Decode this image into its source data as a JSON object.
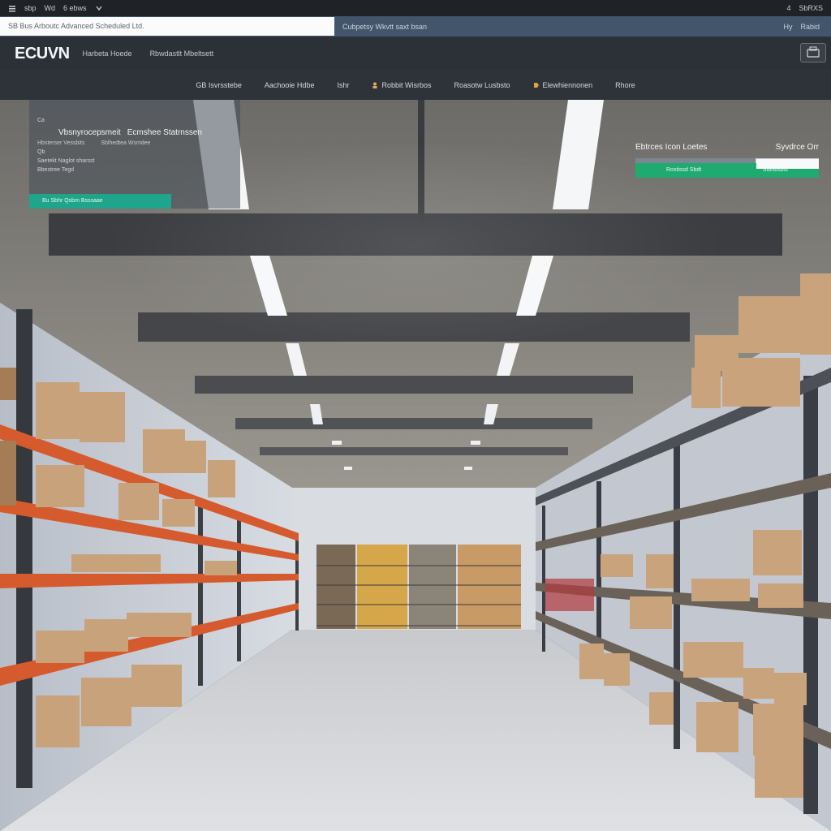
{
  "system_bar": {
    "items": [
      "sbp",
      "Wd",
      "6 ebws"
    ],
    "right": [
      "4",
      "SbRXS"
    ]
  },
  "url_bar": {
    "value": "SB Bus Arboutc Advanced Scheduled Ltd.",
    "center_text": "Cubpetsy Wkvtt saxt bsan",
    "right_text": [
      "Hy",
      "Rabid"
    ]
  },
  "header": {
    "logo": "ECUVN",
    "subnav": [
      "Harbeta Hoede",
      "Rbwdastlt Mbeltsett"
    ]
  },
  "catnav": {
    "items": [
      "GB Isvrsstebe",
      "Aachooie Hdbe",
      "Ishr",
      "Robbit Wisrbos",
      "Roasotw Lusbsto",
      "Elewhiennonen",
      "Rhore"
    ]
  },
  "promo": {
    "line1": "Ca",
    "line2": "Qb",
    "title_left": "Vbsnyrocepsmeit",
    "title_right": "Ecmshee Statrnssen",
    "meta_left": "Hbsterser Vessbits",
    "meta_right": "Sblhedtea Wsmdee",
    "line3": "Saetekt Naglot sharsst",
    "line4": "Bbestree Tegd",
    "cta": "Bu Sbhr Qsbm Bsssaae"
  },
  "signup": {
    "title": "Ebtrces Icon Loetes",
    "price": "Syvdrce Orr",
    "btn_left": "Roxtissd Sbdt",
    "btn_right": "Stbrlbsbst"
  },
  "colors": {
    "accent_teal": "#1ea58b",
    "accent_green": "#1faa6f",
    "nav_bg": "#2e333a",
    "url_bar_bg": "#42556a"
  },
  "icons": [
    "burger-icon",
    "cart-icon",
    "chevron-down-icon"
  ]
}
